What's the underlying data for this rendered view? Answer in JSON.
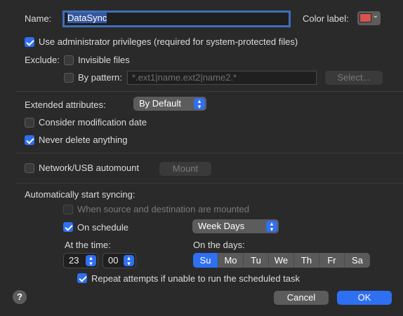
{
  "name_label": "Name:",
  "name_value": "DataSync",
  "color_label": "Color label:",
  "color_value": "#d9534f",
  "use_admin": {
    "label": "Use administrator privileges (required for system-protected files)",
    "checked": true
  },
  "exclude_label": "Exclude:",
  "invisible_files": {
    "label": "Invisible files",
    "checked": false
  },
  "by_pattern": {
    "label": "By pattern:",
    "checked": false,
    "placeholder": "*.ext1|name.ext2|name2.*"
  },
  "select_button": "Select...",
  "extended_attributes": {
    "label": "Extended attributes:",
    "value": "By Default"
  },
  "consider_mod_date": {
    "label": "Consider modification date",
    "checked": false
  },
  "never_delete": {
    "label": "Never delete anything",
    "checked": true
  },
  "network_automount": {
    "label": "Network/USB automount",
    "checked": false
  },
  "mount_button": "Mount",
  "auto_start_label": "Automatically start syncing:",
  "when_mounted": {
    "label": "When source and destination are mounted",
    "checked": false,
    "disabled": true
  },
  "on_schedule": {
    "label": "On schedule",
    "checked": true
  },
  "schedule_value": "Week Days",
  "at_time_label": "At the time:",
  "hour": "23",
  "minute": "00",
  "on_days_label": "On the days:",
  "days": [
    {
      "label": "Su",
      "selected": true
    },
    {
      "label": "Mo",
      "selected": false
    },
    {
      "label": "Tu",
      "selected": false
    },
    {
      "label": "We",
      "selected": false
    },
    {
      "label": "Th",
      "selected": false
    },
    {
      "label": "Fr",
      "selected": false
    },
    {
      "label": "Sa",
      "selected": false
    }
  ],
  "repeat_attempts": {
    "label": "Repeat attempts if unable to run the scheduled task",
    "checked": true
  },
  "help_symbol": "?",
  "cancel_button": "Cancel",
  "ok_button": "OK",
  "colors": {
    "accent": "#2f6ff2",
    "background": "#2a2a2a"
  }
}
